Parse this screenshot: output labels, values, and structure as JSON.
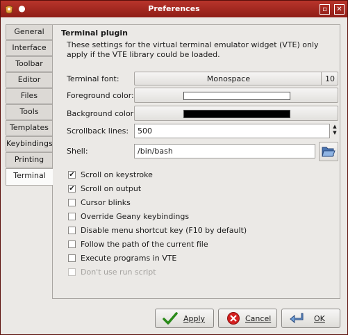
{
  "window": {
    "title": "Preferences"
  },
  "tabs": [
    "General",
    "Interface",
    "Toolbar",
    "Editor",
    "Files",
    "Tools",
    "Templates",
    "Keybindings",
    "Printing",
    "Terminal"
  ],
  "active_tab": "Terminal",
  "section": {
    "heading": "Terminal plugin",
    "description": "These settings for the virtual terminal emulator widget (VTE) only apply if the VTE library could be loaded."
  },
  "form": {
    "font_label": "Terminal font:",
    "font_name": "Monospace",
    "font_size": "10",
    "fg_label": "Foreground color:",
    "fg_color": "#ffffff",
    "bg_label": "Background color:",
    "bg_color": "#000000",
    "scrollback_label": "Scrollback lines:",
    "scrollback_value": "500",
    "shell_label": "Shell:",
    "shell_value": "/bin/bash"
  },
  "checkboxes": [
    {
      "label": "Scroll on keystroke",
      "checked": true,
      "enabled": true
    },
    {
      "label": "Scroll on output",
      "checked": true,
      "enabled": true
    },
    {
      "label": "Cursor blinks",
      "checked": false,
      "enabled": true
    },
    {
      "label": "Override Geany keybindings",
      "checked": false,
      "enabled": true
    },
    {
      "label": "Disable menu shortcut key (F10 by default)",
      "checked": false,
      "enabled": true
    },
    {
      "label": "Follow the path of the current file",
      "checked": false,
      "enabled": true
    },
    {
      "label": "Execute programs in VTE",
      "checked": false,
      "enabled": true
    },
    {
      "label": "Don't use run script",
      "checked": false,
      "enabled": false
    }
  ],
  "buttons": {
    "apply": "Apply",
    "cancel": "Cancel",
    "ok": "OK"
  },
  "colors": {
    "title_bar": "#a52a20",
    "accent_check": "#2a7a1a",
    "cancel_red": "#d42020"
  }
}
